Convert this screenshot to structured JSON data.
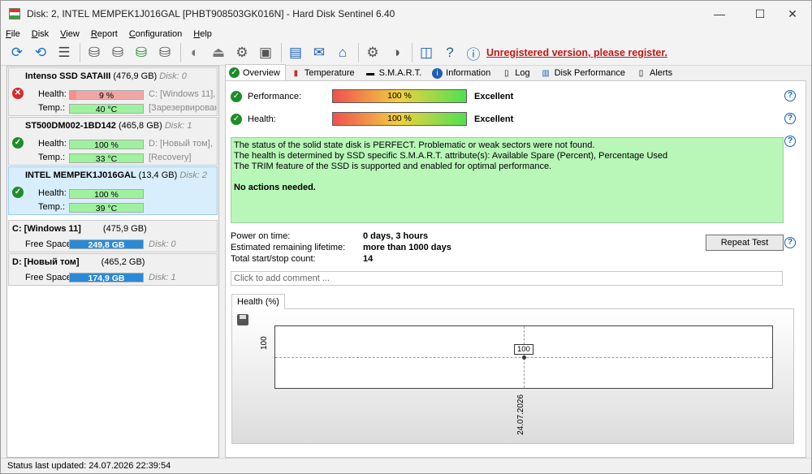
{
  "window": {
    "title": "Disk: 2, INTEL MEMPEK1J016GAL [PHBT908503GK016N]  -  Hard Disk Sentinel 6.40"
  },
  "menu": [
    "File",
    "Disk",
    "View",
    "Report",
    "Configuration",
    "Help"
  ],
  "toolbar": {
    "unregistered": "Unregistered version, please register."
  },
  "disks": [
    {
      "name": "Intenso SSD SATAIII",
      "size": "(476,9 GB)",
      "num": "Disk: 0",
      "health": "9 %",
      "health_pct": 9,
      "temp": "40 °C",
      "part1": "C: [Windows 11],",
      "part2": "[Зарезервировано",
      "status": "bad"
    },
    {
      "name": "ST500DM002-1BD142",
      "size": "(465,8 GB)",
      "num": "Disk: 1",
      "health": "100 %",
      "health_pct": 100,
      "temp": "33 °C",
      "part1": "D: [Новый том],",
      "part2": "[Recovery]",
      "status": "ok"
    },
    {
      "name": "INTEL MEMPEK1J016GAL",
      "size": "(13,4 GB)",
      "num": "Disk: 2",
      "health": "100 %",
      "health_pct": 100,
      "temp": "39 °C",
      "part1": "",
      "part2": "",
      "status": "ok"
    }
  ],
  "labels": {
    "health": "Health:",
    "temp": "Temp.:",
    "free": "Free Space"
  },
  "volumes": [
    {
      "name": "C: [Windows 11]",
      "size": "(475,9 GB)",
      "free": "249,8 GB",
      "num": "Disk: 0"
    },
    {
      "name": "D: [Новый том]",
      "size": "(465,2 GB)",
      "free": "174,9 GB",
      "num": "Disk: 1"
    }
  ],
  "tabs": [
    "Overview",
    "Temperature",
    "S.M.A.R.T.",
    "Information",
    "Log",
    "Disk Performance",
    "Alerts"
  ],
  "overview": {
    "performance_label": "Performance:",
    "performance_value": "100 %",
    "performance_text": "Excellent",
    "health_label": "Health:",
    "health_value": "100 %",
    "health_text": "Excellent",
    "status_lines": [
      "The status of the solid state disk is PERFECT. Problematic or weak sectors were not found.",
      "The health is determined by SSD specific S.M.A.R.T. attribute(s):  Available Spare (Percent), Percentage Used",
      "The TRIM feature of the SSD is supported and enabled for optimal performance."
    ],
    "status_action": "No actions needed.",
    "info": [
      {
        "k": "Power on time:",
        "v": "0 days, 3 hours"
      },
      {
        "k": "Estimated remaining lifetime:",
        "v": "more than 1000 days"
      },
      {
        "k": "Total start/stop count:",
        "v": "14"
      }
    ],
    "repeat_button": "Repeat Test",
    "comment_placeholder": "Click to add comment ..."
  },
  "chart_data": {
    "type": "line",
    "tab": "Health (%)",
    "x": [
      "24.07.2026"
    ],
    "series": [
      {
        "values": [
          100
        ]
      }
    ],
    "point_label": "100",
    "ytick": "100"
  },
  "statusbar": {
    "text": "Status last updated: 24.07.2026 22:39:54"
  }
}
